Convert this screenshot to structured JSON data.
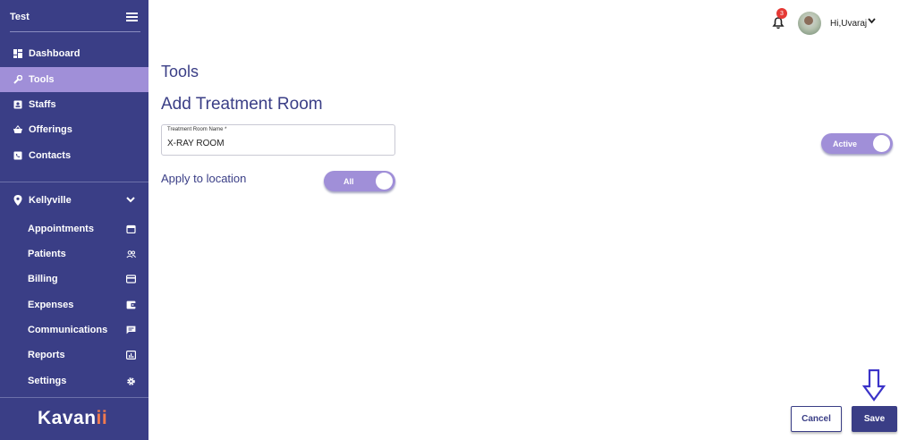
{
  "sidebar": {
    "title": "Test",
    "nav": [
      {
        "label": "Dashboard",
        "icon": "dashboard-icon"
      },
      {
        "label": "Tools",
        "icon": "wrench-icon",
        "active": true
      },
      {
        "label": "Staffs",
        "icon": "badge-icon"
      },
      {
        "label": "Offerings",
        "icon": "basket-icon"
      },
      {
        "label": "Contacts",
        "icon": "phone-book-icon"
      }
    ],
    "location": "Kellyville",
    "sub": [
      {
        "label": "Appointments",
        "icon": "calendar-icon"
      },
      {
        "label": "Patients",
        "icon": "people-icon"
      },
      {
        "label": "Billing",
        "icon": "card-icon"
      },
      {
        "label": "Expenses",
        "icon": "wallet-icon"
      },
      {
        "label": "Communications",
        "icon": "chat-icon"
      },
      {
        "label": "Reports",
        "icon": "chart-icon"
      },
      {
        "label": "Settings",
        "icon": "gear-icon"
      }
    ],
    "logo_main": "Kavan",
    "logo_accent": "ii"
  },
  "header": {
    "notification_count": "3",
    "greeting": "Hi,Uvaraj"
  },
  "main": {
    "page_title": "Tools",
    "section_title": "Add Treatment Room",
    "room_name_label": "Treatment Room Name *",
    "room_name_value": "X-RAY ROOM",
    "apply_label": "Apply to location",
    "apply_toggle_label": "All",
    "status_toggle_label": "Active",
    "cancel_label": "Cancel",
    "save_label": "Save"
  },
  "colors": {
    "sidebar_bg": "#3a3e86",
    "accent": "#a08fd8",
    "logo_accent": "#f07a4f",
    "badge": "#e53935"
  }
}
